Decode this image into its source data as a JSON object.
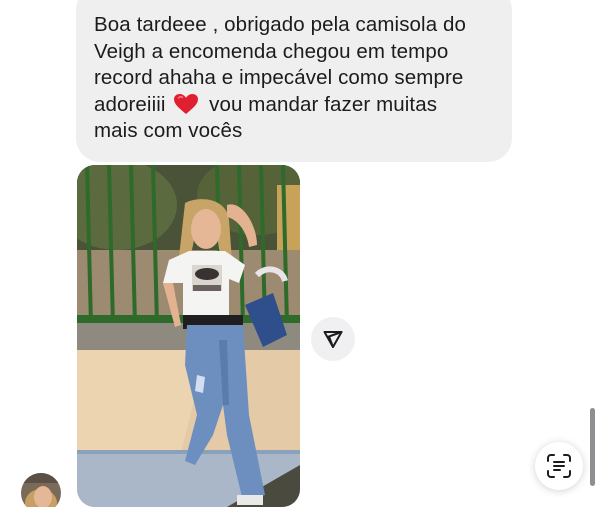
{
  "message": {
    "line1": "Boa tardeee , obrigado pela camisola do",
    "line2": "Veigh a encomenda chegou em tempo",
    "line3": "record ahaha e impecável como sempre",
    "line4_before_emoji": "adoreiiii",
    "emoji": "red-heart",
    "line4_after_emoji": "vou mandar fazer muitas",
    "line5": "mais com vocês"
  },
  "photo": {
    "subject": "woman-in-white-tshirt-and-blue-jeans"
  },
  "icons": {
    "share": "paper-plane-icon",
    "live_text": "live-text-scan-icon"
  },
  "colors": {
    "bubble_background": "#efeff0",
    "text": "#1c1c1e",
    "heart": "#e0202e"
  }
}
